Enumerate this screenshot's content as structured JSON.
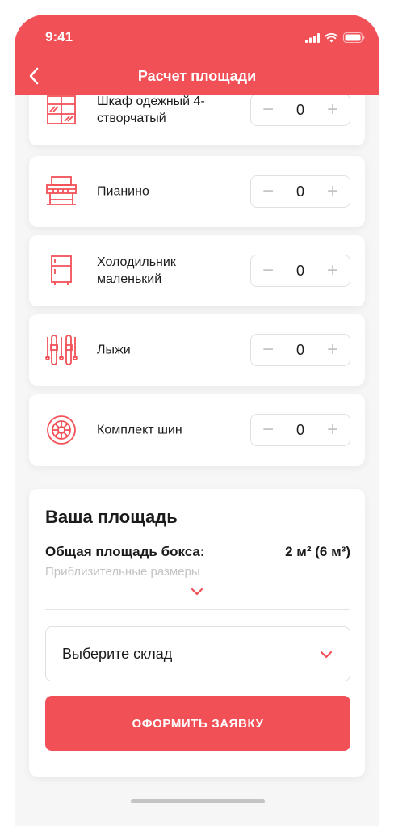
{
  "status_bar": {
    "time": "9:41"
  },
  "header": {
    "title": "Расчет площади"
  },
  "items": [
    {
      "label": "Шкаф одежный 4-створчатый",
      "icon": "wardrobe-icon",
      "count": "0"
    },
    {
      "label": "Пианино",
      "icon": "piano-icon",
      "count": "0"
    },
    {
      "label": "Холодильник маленький",
      "icon": "fridge-icon",
      "count": "0"
    },
    {
      "label": "Лыжи",
      "icon": "skis-icon",
      "count": "0"
    },
    {
      "label": "Комплект шин",
      "icon": "tire-icon",
      "count": "0"
    }
  ],
  "stepper": {
    "minus": "−",
    "plus": "+"
  },
  "summary": {
    "title": "Ваша площадь",
    "area_label": "Общая площадь бокса:",
    "area_value": "2 м² (6 м³)",
    "hint": "Приблизительные размеры"
  },
  "warehouse_select": {
    "placeholder": "Выберите склад"
  },
  "submit_label": "ОФОРМИТЬ ЗАЯВКУ",
  "colors": {
    "accent": "#f25057",
    "background": "#f6f6f6",
    "border": "#e1e1e1",
    "muted": "#c4c4c4"
  }
}
